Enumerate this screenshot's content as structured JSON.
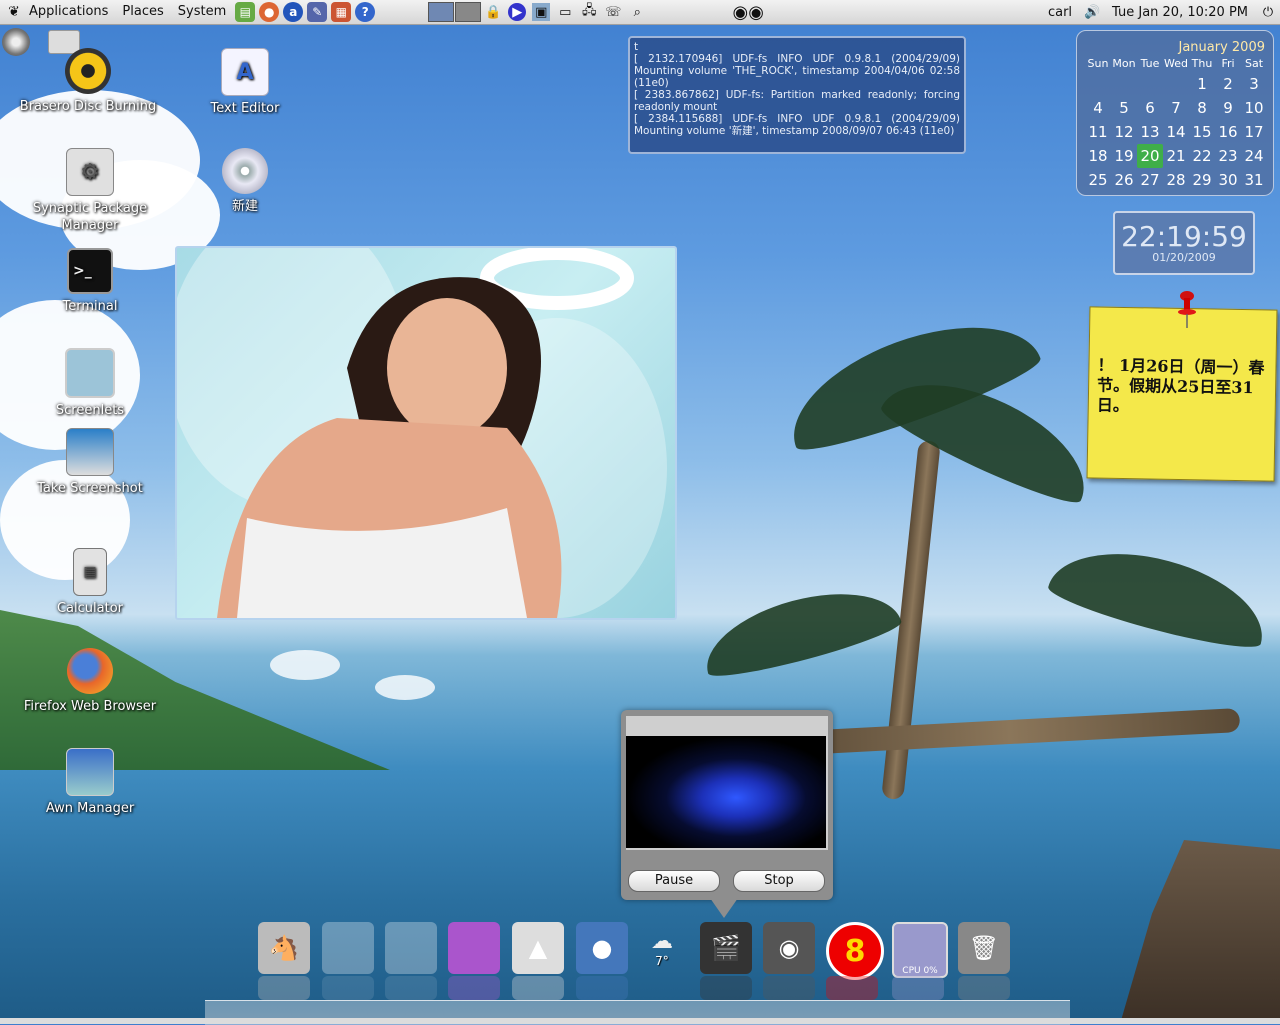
{
  "top_panel": {
    "menus": [
      "Applications",
      "Places",
      "System"
    ],
    "user": "carl",
    "datetime": "Tue Jan 20, 10:20 PM"
  },
  "desktop_icons": [
    {
      "label": "Brasero Disc Burning",
      "icon": "radiation-disc-icon",
      "color": "#222"
    },
    {
      "label": "Text Editor",
      "icon": "text-editor-icon",
      "color": "#eef"
    },
    {
      "label": "Synaptic Package Manager",
      "icon": "package-icon",
      "color": "#ddd"
    },
    {
      "label": "新建",
      "icon": "cd-icon",
      "color": "#ccc"
    },
    {
      "label": "Terminal",
      "icon": "terminal-icon",
      "color": "#111"
    },
    {
      "label": "Screenlets",
      "icon": "screenlets-icon",
      "color": "#9bc"
    },
    {
      "label": "Take Screenshot",
      "icon": "camera-icon",
      "color": "#8ac"
    },
    {
      "label": "Calculator",
      "icon": "calculator-icon",
      "color": "#ddd"
    },
    {
      "label": "Firefox Web Browser",
      "icon": "firefox-icon",
      "color": "#e66"
    },
    {
      "label": "Awn Manager",
      "icon": "awn-manager-icon",
      "color": "#58c"
    }
  ],
  "log": {
    "lines": [
      "t",
      "[ 2132.170946] UDF-fs INFO UDF 0.9.8.1 (2004/29/09) Mounting volume 'THE_ROCK', timestamp 2004/04/06 02:58 (11e0)",
      "[ 2383.867862] UDF-fs: Partition marked readonly; forcing readonly mount",
      "[ 2384.115688] UDF-fs INFO UDF 0.9.8.1 (2004/29/09) Mounting volume '新建', timestamp 2008/09/07 06:43 (11e0)"
    ]
  },
  "calendar": {
    "title": "January 2009",
    "days_of_week": [
      "Sun",
      "Mon",
      "Tue",
      "Wed",
      "Thu",
      "Fri",
      "Sat"
    ],
    "days": [
      "",
      "",
      "",
      "",
      "1",
      "2",
      "3",
      "4",
      "5",
      "6",
      "7",
      "8",
      "9",
      "10",
      "11",
      "12",
      "13",
      "14",
      "15",
      "16",
      "17",
      "18",
      "19",
      "20",
      "21",
      "22",
      "23",
      "24",
      "25",
      "26",
      "27",
      "28",
      "29",
      "30",
      "31"
    ],
    "today": "20"
  },
  "clock": {
    "time": "22:19:59",
    "date": "01/20/2009"
  },
  "note": {
    "text": "！ 1月26日（周一）春节。假期从25日至31日。"
  },
  "media_player": {
    "pause_label": "Pause",
    "stop_label": "Stop"
  },
  "dock": {
    "items": [
      {
        "name": "donkey-icon",
        "color": "#bbb",
        "glyph": "🐴"
      },
      {
        "name": "empty-slot-icon",
        "color": "rgba(255,255,255,.3)",
        "glyph": ""
      },
      {
        "name": "empty-slot-icon",
        "color": "rgba(255,255,255,.3)",
        "glyph": ""
      },
      {
        "name": "wallpaper-icon",
        "color": "#a5c",
        "glyph": ""
      },
      {
        "name": "mountain-icon",
        "color": "#ddd",
        "glyph": "▲"
      },
      {
        "name": "globe-icon",
        "color": "#47b",
        "glyph": "●"
      },
      {
        "name": "weather-icon",
        "color": "transparent",
        "glyph": "☁"
      },
      {
        "name": "media-icon",
        "color": "#333",
        "glyph": "🎬"
      },
      {
        "name": "speaker-icon",
        "color": "#555",
        "glyph": "◉"
      },
      {
        "name": "badge-icon",
        "color": "#e00",
        "glyph": "8"
      },
      {
        "name": "cpu-monitor-icon",
        "color": "#99c",
        "glyph": ""
      },
      {
        "name": "trash-icon",
        "color": "#888",
        "glyph": "🗑"
      }
    ],
    "weather_temp": "7°",
    "cpu_label": "CPU 0%"
  },
  "colors": {
    "panel": "#e4e4e4",
    "note": "#f4e84a",
    "today": "#3fae49"
  }
}
